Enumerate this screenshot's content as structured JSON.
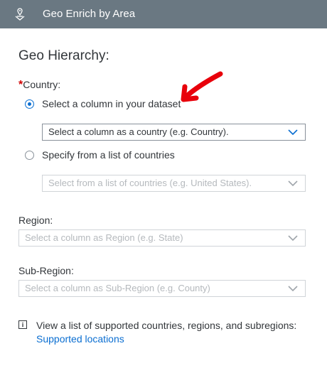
{
  "header": {
    "title": "Geo Enrich by Area",
    "icon": "location-pin-icon"
  },
  "section_title": "Geo Hierarchy:",
  "country": {
    "required_mark": "*",
    "label": "Country:",
    "option_column": {
      "label": "Select a column in your dataset",
      "selected": true
    },
    "column_select": {
      "value": "Select a column as a country (e.g. Country)."
    },
    "option_list": {
      "label": "Specify from a list of countries",
      "selected": false
    },
    "list_select": {
      "placeholder": "Select from a list of countries (e.g. United States)."
    }
  },
  "region": {
    "label": "Region:",
    "select": {
      "placeholder": "Select a column as Region (e.g. State)"
    }
  },
  "subregion": {
    "label": "Sub-Region:",
    "select": {
      "placeholder": "Select a column as Sub-Region (e.g. County)"
    }
  },
  "info": {
    "text": "View a list of supported countries, regions, and subregions:",
    "link": "Supported locations"
  },
  "colors": {
    "header": "#6a7882",
    "accent": "#0a6ed1",
    "required": "#d00000",
    "annotation_arrow": "#e8000b"
  }
}
